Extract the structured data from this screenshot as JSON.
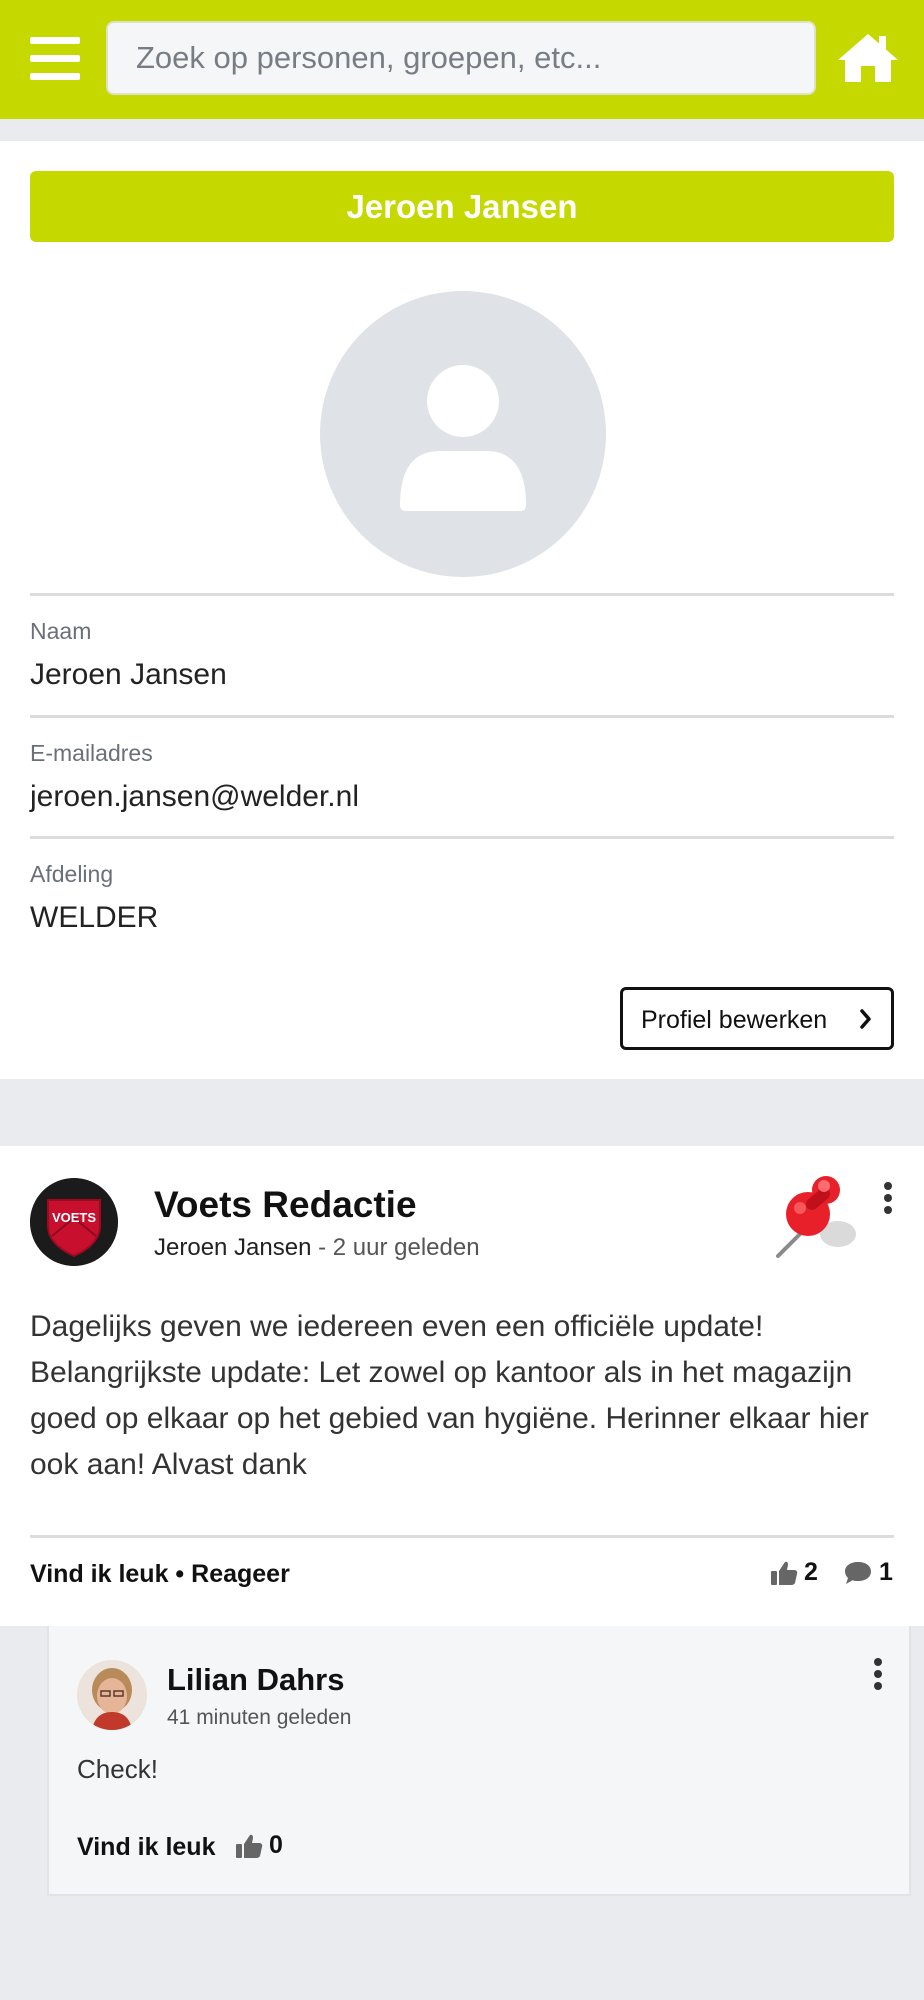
{
  "header": {
    "search_placeholder": "Zoek op personen, groepen, etc...",
    "brand_color": "#c5d900"
  },
  "profile": {
    "name_banner": "Jeroen Jansen",
    "fields": [
      {
        "label": "Naam",
        "value": "Jeroen Jansen"
      },
      {
        "label": "E-mailadres",
        "value": "jeroen.jansen@welder.nl"
      },
      {
        "label": "Afdeling",
        "value": "WELDER"
      }
    ],
    "edit_button": "Profiel bewerken"
  },
  "post": {
    "avatar_text": "VOETS",
    "author": "Voets Redactie",
    "poster": "Jeroen Jansen",
    "time": " - 2 uur geleden",
    "body": "Dagelijks geven we iedereen even een officiële update! Belangrijkste update: Let zowel op kantoor als in het magazijn goed op elkaar op het gebied van hygiëne. Herinner elkaar hier ook aan! Alvast dank",
    "like_action": "Vind ik leuk",
    "separator": " • ",
    "reply_action": "Reageer",
    "likes": "2",
    "comments": "1"
  },
  "comment": {
    "author": "Lilian Dahrs",
    "time": "41 minuten geleden",
    "text": "Check!",
    "like_action": "Vind ik leuk",
    "likes": "0"
  }
}
